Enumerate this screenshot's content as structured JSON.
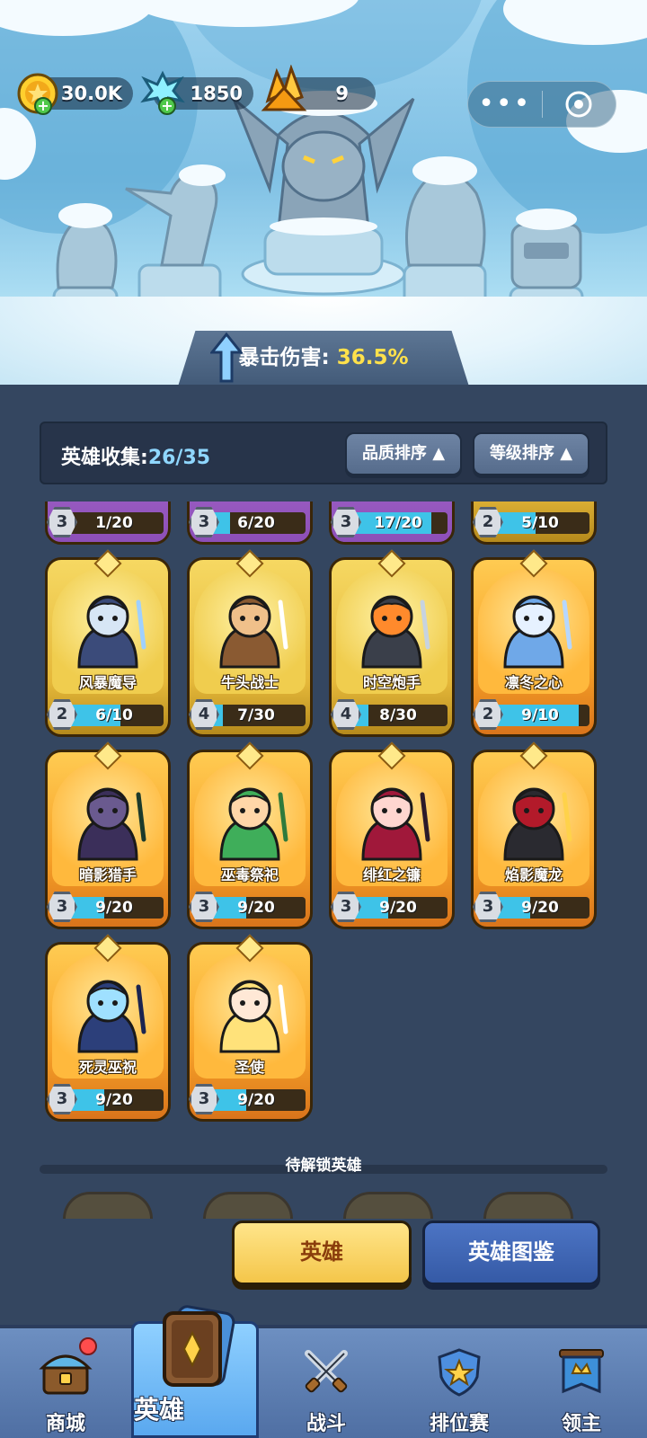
{
  "resources": {
    "gold": "30.0K",
    "diamonds": "1850",
    "crystals": "9"
  },
  "stats": {
    "crit_label": "暴击伤害:",
    "crit_value": "36.5%"
  },
  "collection": {
    "label": "英雄收集:",
    "value": "26/35",
    "sort_quality": "品质排序",
    "sort_level": "等级排序"
  },
  "heroes": [
    {
      "name": "",
      "level": "3",
      "progress": "1/20",
      "fill": 0.05,
      "rarity": "purple"
    },
    {
      "name": "",
      "level": "3",
      "progress": "6/20",
      "fill": 0.3,
      "rarity": "purple"
    },
    {
      "name": "",
      "level": "3",
      "progress": "17/20",
      "fill": 0.85,
      "rarity": "purple"
    },
    {
      "name": "",
      "level": "2",
      "progress": "5/10",
      "fill": 0.5,
      "rarity": "gold"
    },
    {
      "name": "风暴魔导",
      "level": "2",
      "progress": "6/10",
      "fill": 0.6,
      "rarity": "gold",
      "icon": "storm-mage-portrait"
    },
    {
      "name": "牛头战士",
      "level": "4",
      "progress": "7/30",
      "fill": 0.23,
      "rarity": "gold",
      "icon": "minotaur-portrait"
    },
    {
      "name": "时空炮手",
      "level": "4",
      "progress": "8/30",
      "fill": 0.27,
      "rarity": "gold",
      "icon": "gunner-portrait"
    },
    {
      "name": "凛冬之心",
      "level": "2",
      "progress": "9/10",
      "fill": 0.9,
      "rarity": "orange",
      "icon": "ice-queen-portrait"
    },
    {
      "name": "暗影猎手",
      "level": "3",
      "progress": "9/20",
      "fill": 0.45,
      "rarity": "orange",
      "icon": "shadow-hunter-portrait"
    },
    {
      "name": "巫毒祭祀",
      "level": "3",
      "progress": "9/20",
      "fill": 0.45,
      "rarity": "orange",
      "icon": "voodoo-priest-portrait"
    },
    {
      "name": "绯红之镰",
      "level": "3",
      "progress": "9/20",
      "fill": 0.45,
      "rarity": "orange",
      "icon": "crimson-scythe-portrait"
    },
    {
      "name": "焰影魔龙",
      "level": "3",
      "progress": "9/20",
      "fill": 0.45,
      "rarity": "orange",
      "icon": "shadow-dragon-portrait"
    },
    {
      "name": "死灵巫祝",
      "level": "3",
      "progress": "9/20",
      "fill": 0.45,
      "rarity": "orange",
      "icon": "necromancer-portrait"
    },
    {
      "name": "圣使",
      "level": "3",
      "progress": "9/20",
      "fill": 0.45,
      "rarity": "orange",
      "icon": "angel-portrait"
    }
  ],
  "unlock": {
    "title": "待解锁英雄"
  },
  "actions": {
    "hero": "英雄",
    "codex": "英雄图鉴"
  },
  "nav": {
    "shop": "商城",
    "heroes": "英雄",
    "battle": "战斗",
    "ranked": "排位赛",
    "lord": "领主"
  }
}
